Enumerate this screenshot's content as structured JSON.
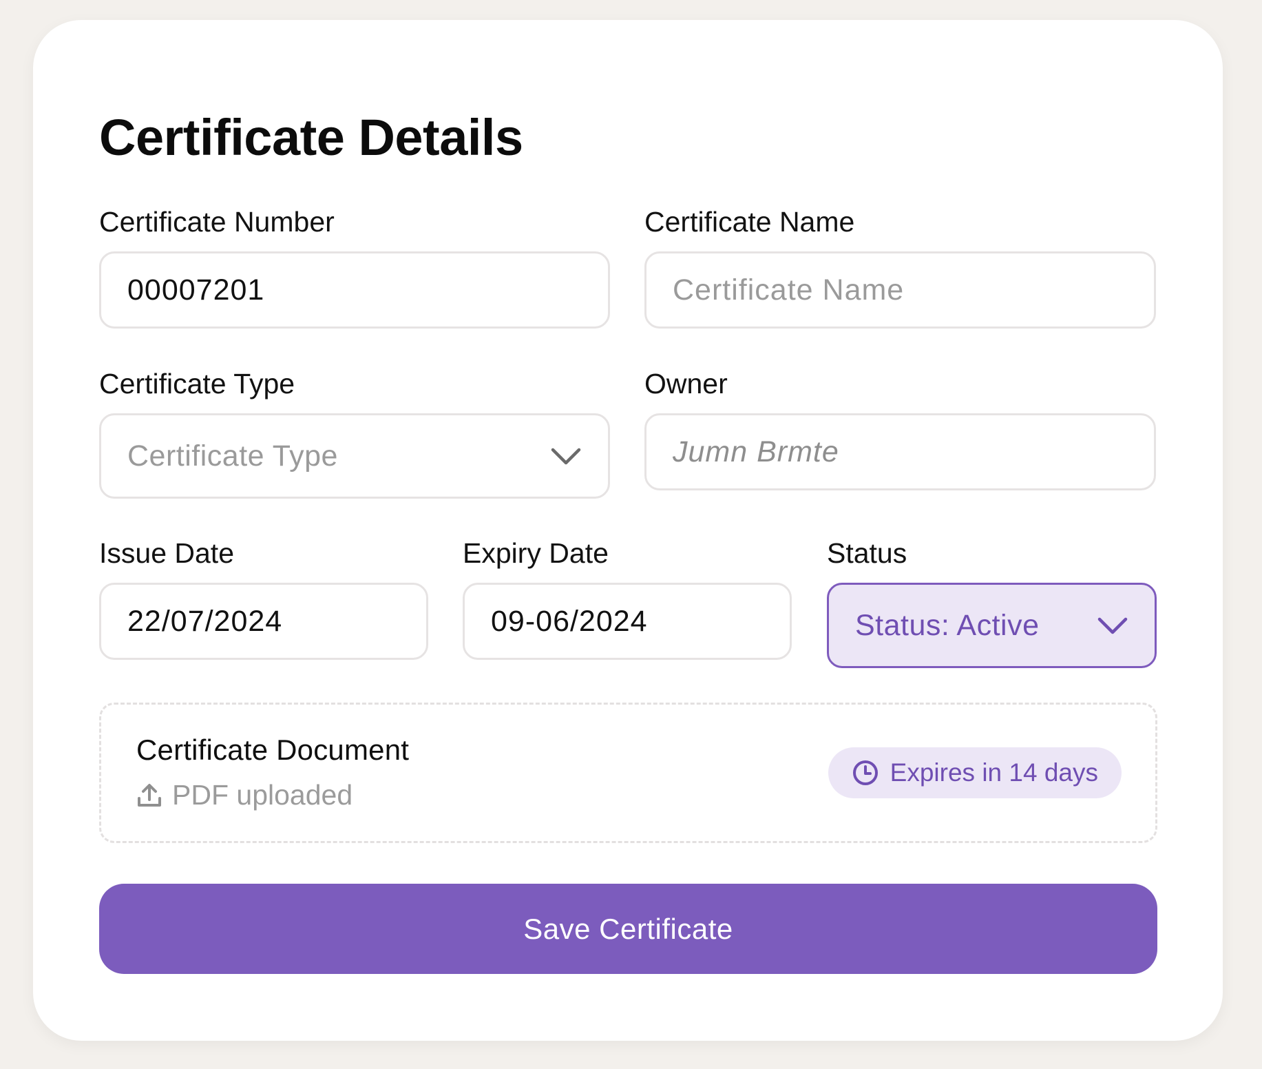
{
  "form": {
    "title": "Certificate Details",
    "certificate_number": {
      "label": "Certificate Number",
      "value": "00007201"
    },
    "certificate_name": {
      "label": "Certificate Name",
      "value": "",
      "placeholder": "Certificate Name"
    },
    "certificate_type": {
      "label": "Certificate Type",
      "placeholder": "Certificate Type",
      "icon": "chevron-down-icon"
    },
    "owner": {
      "label": "Owner",
      "value": "",
      "placeholder": "Jumn Brmte"
    },
    "issue_date": {
      "label": "Issue Date",
      "value": "22/07/2024"
    },
    "expiry_date": {
      "label": "Expiry Date",
      "value": "09-06/2024"
    },
    "status": {
      "label": "Status",
      "selected": "Status: Active",
      "icon": "chevron-down-icon"
    }
  },
  "document": {
    "title": "Certificate Document",
    "status_text": "PDF uploaded",
    "upload_icon": "upload-icon",
    "badge_text": "Expires in 14 days",
    "badge_icon": "clock-icon"
  },
  "actions": {
    "save_label": "Save Certificate"
  },
  "colors": {
    "accent": "#7c5cbd",
    "accent_light": "#ece6f6",
    "background": "#f3f0ec",
    "card": "#ffffff",
    "placeholder": "#9a9a9a"
  }
}
